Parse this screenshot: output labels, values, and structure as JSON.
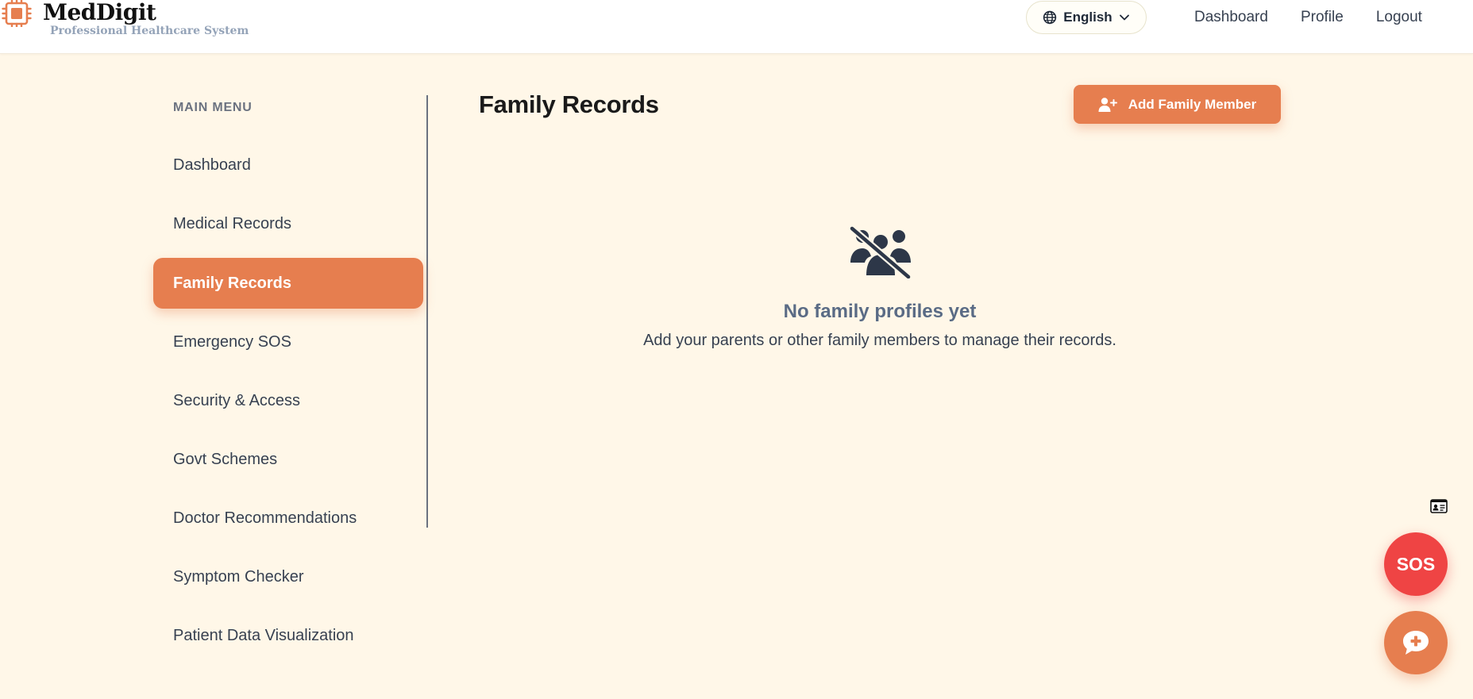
{
  "brand": {
    "name": "MedDigit",
    "tagline": "Professional Healthcare System"
  },
  "header": {
    "language": "English",
    "nav": [
      "Dashboard",
      "Profile",
      "Logout"
    ]
  },
  "sidebar": {
    "heading": "MAIN MENU",
    "items": [
      {
        "label": "Dashboard",
        "active": false
      },
      {
        "label": "Medical Records",
        "active": false
      },
      {
        "label": "Family Records",
        "active": true
      },
      {
        "label": "Emergency SOS",
        "active": false
      },
      {
        "label": "Security & Access",
        "active": false
      },
      {
        "label": "Govt Schemes",
        "active": false
      },
      {
        "label": "Doctor Recommendations",
        "active": false
      },
      {
        "label": "Symptom Checker",
        "active": false
      },
      {
        "label": "Patient Data Visualization",
        "active": false
      }
    ]
  },
  "main": {
    "title": "Family Records",
    "add_button": "Add Family Member",
    "empty_title": "No family profiles yet",
    "empty_subtitle": "Add your parents or other family members to manage their records."
  },
  "floating": {
    "sos_label": "SOS"
  },
  "colors": {
    "accent": "#e67e4f",
    "sos": "#ef4444",
    "background": "#fff7e8",
    "muted_title": "#5a6b85"
  },
  "icons": {
    "brand": "chip-icon",
    "language": "globe-icon",
    "dropdown": "chevron-down-icon",
    "add_member": "user-plus-icon",
    "empty_state": "users-slash-icon",
    "card": "id-card-icon",
    "chat": "medical-chat-icon"
  }
}
